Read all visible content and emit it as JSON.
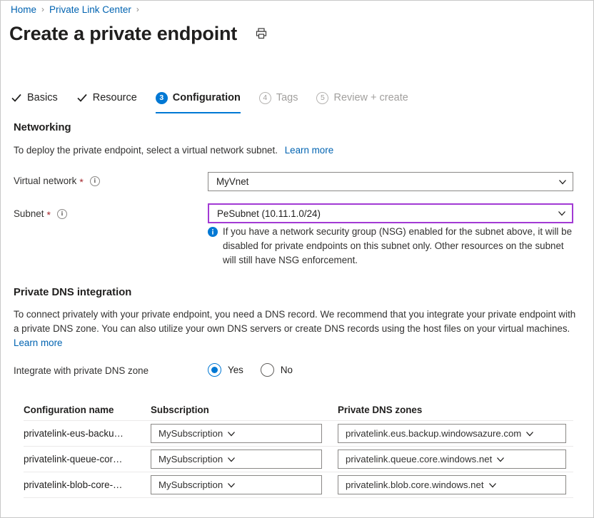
{
  "breadcrumb": {
    "items": [
      {
        "label": "Home"
      },
      {
        "label": "Private Link Center"
      }
    ],
    "separator": "›",
    "trailing_separator": "›"
  },
  "header": {
    "title": "Create a private endpoint",
    "print_icon": "printer-icon"
  },
  "wizard": {
    "tabs": [
      {
        "label": "Basics",
        "state": "complete",
        "marker": "check"
      },
      {
        "label": "Resource",
        "state": "complete",
        "marker": "check"
      },
      {
        "label": "Configuration",
        "state": "active",
        "marker": "3"
      },
      {
        "label": "Tags",
        "state": "disabled",
        "marker": "4"
      },
      {
        "label": "Review + create",
        "state": "disabled",
        "marker": "5"
      }
    ]
  },
  "networking": {
    "heading": "Networking",
    "description": "To deploy the private endpoint, select a virtual network subnet.",
    "learn_more": "Learn more",
    "virtual_network": {
      "label": "Virtual network",
      "required_marker": "*",
      "info_icon": "info-icon",
      "value": "MyVnet"
    },
    "subnet": {
      "label": "Subnet",
      "required_marker": "*",
      "info_icon": "info-icon",
      "value": "PeSubnet (10.11.1.0/24)",
      "focus_border_color": "#a23ad4"
    },
    "nsg_notice": {
      "icon": "info-filled-icon",
      "text": "If you have a network security group (NSG) enabled for the subnet above, it will be disabled for private endpoints on this subnet only. Other resources on the subnet will still have NSG enforcement."
    }
  },
  "private_dns": {
    "heading": "Private DNS integration",
    "description": "To connect privately with your private endpoint, you need a DNS record. We recommend that you integrate your private endpoint with a private DNS zone. You can also utilize your own DNS servers or create DNS records using the host files on your virtual machines.",
    "learn_more": "Learn more",
    "integrate": {
      "label": "Integrate with private DNS zone",
      "options": [
        {
          "label": "Yes",
          "selected": true
        },
        {
          "label": "No",
          "selected": false
        }
      ]
    },
    "table": {
      "columns": [
        "Configuration name",
        "Subscription",
        "Private DNS zones"
      ],
      "rows": [
        {
          "configuration_name": "privatelink-eus-backu…",
          "subscription": "MySubscription",
          "dns_zone": "privatelink.eus.backup.windowsazure.com"
        },
        {
          "configuration_name": "privatelink-queue-cor…",
          "subscription": "MySubscription",
          "dns_zone": "privatelink.queue.core.windows.net"
        },
        {
          "configuration_name": "privatelink-blob-core-…",
          "subscription": "MySubscription",
          "dns_zone": "privatelink.blob.core.windows.net"
        }
      ]
    }
  },
  "colors": {
    "accent": "#0078d4",
    "link": "#0063b1",
    "required": "#a4262c",
    "focus": "#a23ad4",
    "muted": "#a19f9d"
  }
}
